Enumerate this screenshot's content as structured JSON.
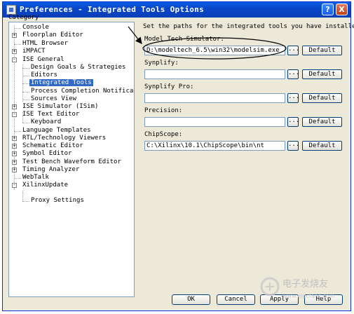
{
  "window": {
    "title": "Preferences - Integrated Tools Options",
    "help_glyph": "?",
    "close_glyph": "X"
  },
  "category": {
    "label": "Category",
    "items": [
      {
        "label": "Console"
      },
      {
        "label": "Floorplan Editor",
        "expander": "+"
      },
      {
        "label": "HTML Browser"
      },
      {
        "label": "iMPACT",
        "expander": "+"
      },
      {
        "label": "ISE General",
        "expander": "-"
      },
      {
        "label": "Design Goals & Strategies"
      },
      {
        "label": "Editors"
      },
      {
        "label": "Integrated Tools",
        "selected": true
      },
      {
        "label": "Process Completion Notification"
      },
      {
        "label": "Sources View"
      },
      {
        "label": "ISE Simulator (ISim)",
        "expander": "+"
      },
      {
        "label": "ISE Text Editor",
        "expander": "-"
      },
      {
        "label": "Keyboard"
      },
      {
        "label": "Language Templates"
      },
      {
        "label": "RTL/Technology Viewers",
        "expander": "+"
      },
      {
        "label": "Schematic Editor",
        "expander": "+"
      },
      {
        "label": "Symbol Editor",
        "expander": "+"
      },
      {
        "label": "Test Bench Waveform Editor",
        "expander": "+"
      },
      {
        "label": "Timing Analyzer",
        "expander": "+"
      },
      {
        "label": "WebTalk"
      },
      {
        "label": "XilinxUpdate",
        "expander": "-"
      },
      {
        "label": "Proxy Settings"
      }
    ]
  },
  "panel": {
    "description": "Set the paths for the integrated tools you have installed.",
    "fields": [
      {
        "label": "Model Tech Simulator:",
        "value": "D:\\modeltech_6.5\\win32\\modelsim.exe"
      },
      {
        "label": "Synplify:",
        "value": ""
      },
      {
        "label": "Synplify Pro:",
        "value": ""
      },
      {
        "label": "Precision:",
        "value": ""
      },
      {
        "label": "ChipScope:",
        "value": "C:\\Xilinx\\10.1\\ChipScope\\bin\\nt"
      }
    ],
    "browse_label": "...",
    "default_label": "Default"
  },
  "buttons": {
    "ok": "OK",
    "cancel": "Cancel",
    "apply": "Apply",
    "help": "Help"
  },
  "watermark": {
    "text": "电子发烧友",
    "url": "www.elecfans.com"
  }
}
